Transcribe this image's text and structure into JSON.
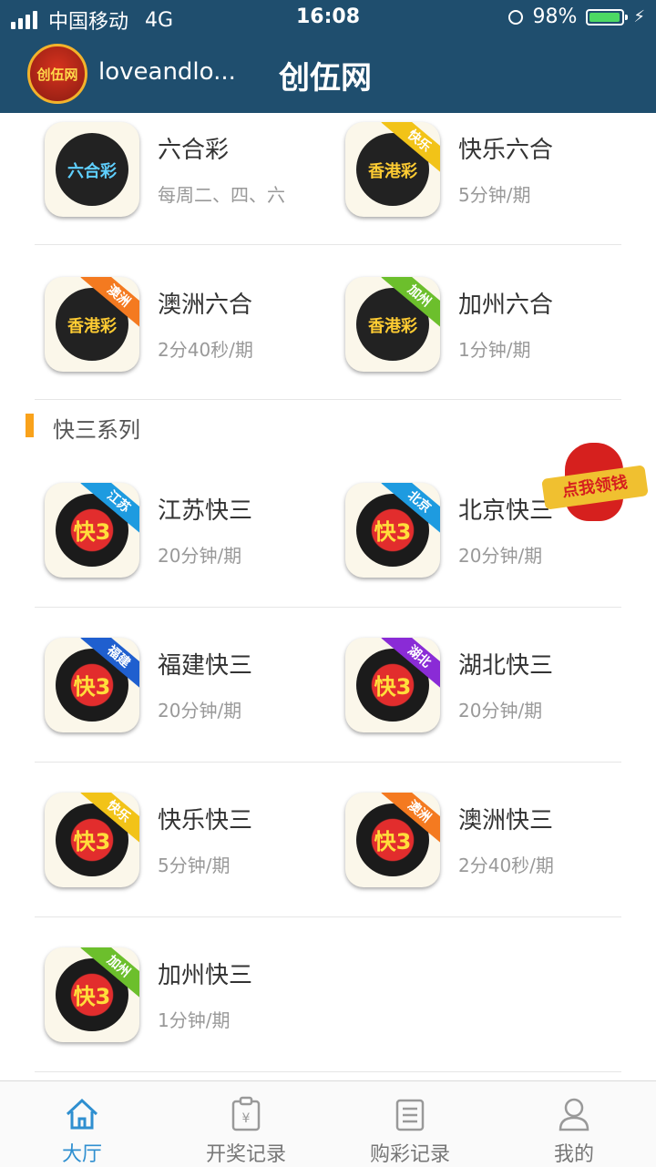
{
  "status_bar": {
    "carrier": "中国移动",
    "network": "4G",
    "time": "16:08",
    "battery": "98%",
    "battery_level": 0.98,
    "icons": [
      "signal-icon",
      "alarm-icon",
      "battery-icon",
      "charging-bolt-icon"
    ]
  },
  "header": {
    "logo_text": "创伍网",
    "username": "loveandlo...",
    "title": "创伍网"
  },
  "liuhecai": [
    {
      "name": "六合彩",
      "period": "每周二、四、六",
      "icon_text": "六合彩",
      "ribbon": "",
      "ribbon_color": ""
    },
    {
      "name": "快乐六合",
      "period": "5分钟/期",
      "icon_text": "香港彩",
      "ribbon": "快乐",
      "ribbon_color": "#f2c318"
    },
    {
      "name": "澳洲六合",
      "period": "2分40秒/期",
      "icon_text": "香港彩",
      "ribbon": "澳洲",
      "ribbon_color": "#f47a20"
    },
    {
      "name": "加州六合",
      "period": "1分钟/期",
      "icon_text": "香港彩",
      "ribbon": "加州",
      "ribbon_color": "#6cbf2c"
    }
  ],
  "section": {
    "title": "快三系列",
    "accent_color": "#f9a21b"
  },
  "kuaisan": [
    {
      "name": "江苏快三",
      "period": "20分钟/期",
      "icon_text": "快3",
      "ribbon": "江苏",
      "ribbon_color": "#1e9be0"
    },
    {
      "name": "北京快三",
      "period": "20分钟/期",
      "icon_text": "快3",
      "ribbon": "北京",
      "ribbon_color": "#1e9be0"
    },
    {
      "name": "福建快三",
      "period": "20分钟/期",
      "icon_text": "快3",
      "ribbon": "福建",
      "ribbon_color": "#1f5fcf"
    },
    {
      "name": "湖北快三",
      "period": "20分钟/期",
      "icon_text": "快3",
      "ribbon": "湖北",
      "ribbon_color": "#8a2bd6"
    },
    {
      "name": "快乐快三",
      "period": "5分钟/期",
      "icon_text": "快3",
      "ribbon": "快乐",
      "ribbon_color": "#f2c318"
    },
    {
      "name": "澳洲快三",
      "period": "2分40秒/期",
      "icon_text": "快3",
      "ribbon": "澳洲",
      "ribbon_color": "#f47a20"
    },
    {
      "name": "加州快三",
      "period": "1分钟/期",
      "icon_text": "快3",
      "ribbon": "加州",
      "ribbon_color": "#6cbf2c"
    }
  ],
  "red_packet": {
    "label": "点我领钱"
  },
  "tabs": [
    {
      "label": "大厅",
      "icon": "home-icon",
      "active": true
    },
    {
      "label": "开奖记录",
      "icon": "clipboard-yen-icon",
      "active": false
    },
    {
      "label": "购彩记录",
      "icon": "list-document-icon",
      "active": false
    },
    {
      "label": "我的",
      "icon": "user-icon",
      "active": false
    }
  ],
  "colors": {
    "header_bg": "#1f4e6e",
    "tab_active": "#2f8fd0"
  }
}
